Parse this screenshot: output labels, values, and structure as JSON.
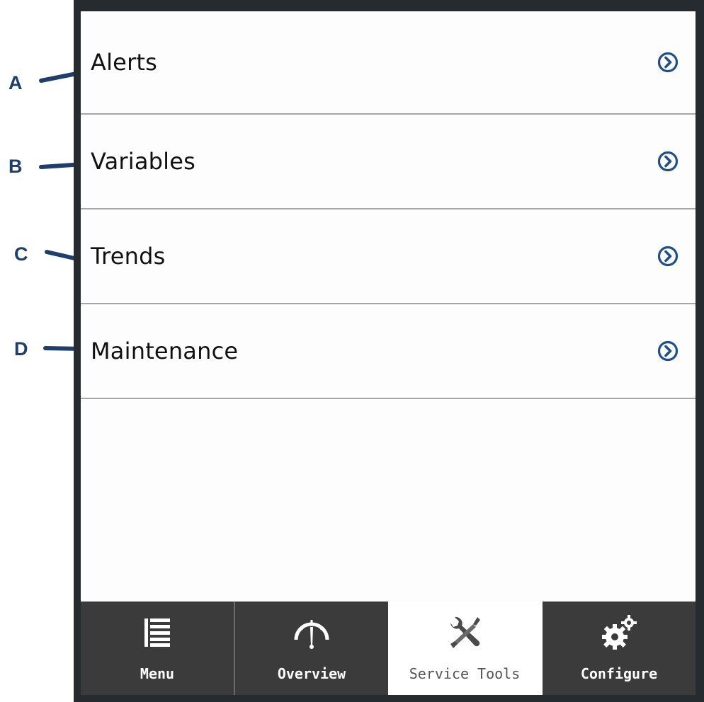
{
  "menu": {
    "items": [
      {
        "label": "Alerts",
        "annotation": "A"
      },
      {
        "label": "Variables",
        "annotation": "B"
      },
      {
        "label": "Trends",
        "annotation": "C"
      },
      {
        "label": "Maintenance",
        "annotation": "D"
      }
    ]
  },
  "navbar": {
    "tabs": [
      {
        "label": "Menu",
        "icon": "list-icon",
        "active": false
      },
      {
        "label": "Overview",
        "icon": "gauge-icon",
        "active": false
      },
      {
        "label": "Service Tools",
        "icon": "wrench-screwdriver-icon",
        "active": true
      },
      {
        "label": "Configure",
        "icon": "gears-icon",
        "active": false
      }
    ]
  },
  "colors": {
    "annotation": "#1e3e6b",
    "chevron": "#1f4f86",
    "tab_bg": "#3b3b3b",
    "tab_active_bg": "#ffffff",
    "frame": "#262b30"
  }
}
